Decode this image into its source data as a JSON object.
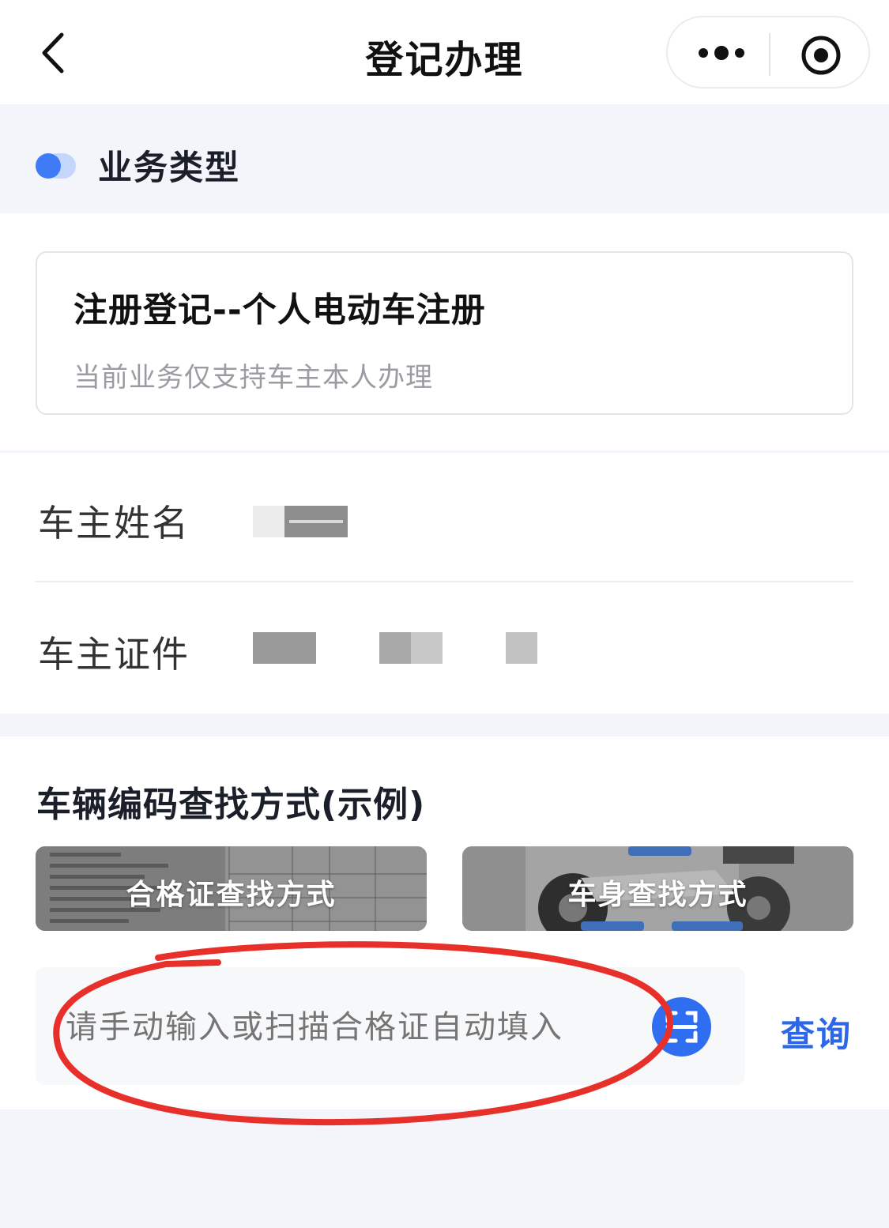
{
  "nav": {
    "title": "登记办理"
  },
  "business_type": {
    "title": "业务类型"
  },
  "service_card": {
    "title": "注册登记--个人电动车注册",
    "subtitle": "当前业务仅支持车主本人办理"
  },
  "owner": {
    "name_label": "车主姓名",
    "id_label": "车主证件"
  },
  "vehicle_code": {
    "title": "车辆编码查找方式(示例)",
    "guides": [
      "合格证查找方式",
      "车身查找方式"
    ],
    "input_placeholder": "请手动输入或扫描合格证自动填入",
    "query_label": "查询"
  },
  "colors": {
    "accent": "#2f6ef0",
    "query": "#2b67e8",
    "annotation": "#e8302a"
  },
  "icons": {
    "back": "chevron-left-icon",
    "more": "more-dots-icon",
    "close": "target-icon",
    "scan": "scan-icon"
  }
}
